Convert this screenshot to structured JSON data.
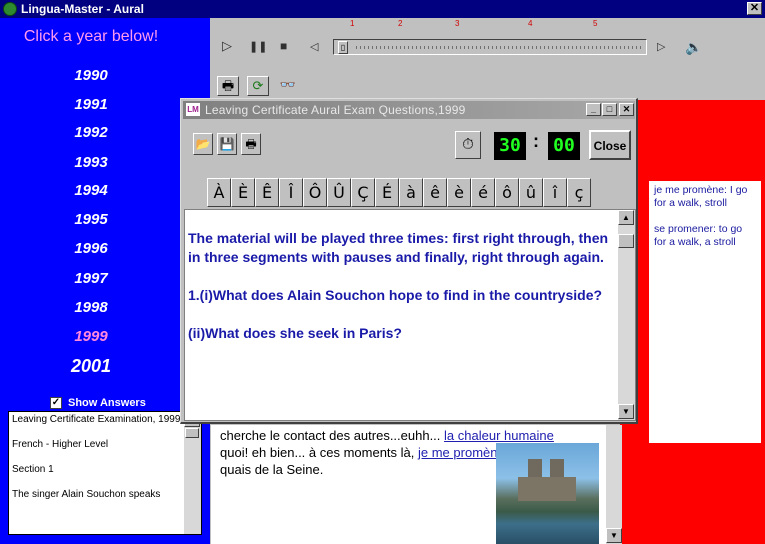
{
  "window": {
    "title": "Lingua-Master - Aural",
    "close_glyph": "✕"
  },
  "years_panel": {
    "heading": "Click a year below!",
    "years": [
      "1990",
      "1991",
      "1992",
      "1993",
      "1994",
      "1995",
      "1996",
      "1997",
      "1998",
      "1999",
      "2001"
    ],
    "selected_year": "1999"
  },
  "show_answers": {
    "label": "Show Answers",
    "checked": true,
    "check_glyph": "✓"
  },
  "info_box": {
    "lines": [
      "Leaving Certificate Examination, 1999",
      "French - Higher Level",
      "Section 1",
      "The singer Alain Souchon speaks"
    ]
  },
  "player": {
    "segment_markers": [
      "1",
      "2",
      "3",
      "4",
      "5"
    ],
    "play_glyph": "▷",
    "pause_glyph": "❚❚",
    "stop_glyph": "■",
    "prev_glyph": "◁",
    "next_glyph": "▷",
    "speaker_glyph": "🔈",
    "thumb_glyph": "▯"
  },
  "toolbar2": {
    "print_glyph": "🖶",
    "refresh_glyph": "⟳",
    "find_glyph": "👓"
  },
  "dialog": {
    "title": "Leaving Certificate Aural Exam Questions,1999",
    "icon_text": "LM",
    "minimize_glyph": "_",
    "maximize_glyph": "□",
    "close_glyph": "✕",
    "open_glyph": "📂",
    "save_glyph": "💾",
    "print_glyph": "🖶",
    "stopwatch_glyph": "⏱",
    "timer_minutes": "30",
    "timer_seconds": "00",
    "timer_sep": ":",
    "close_label": "Close",
    "accents": [
      "À",
      "È",
      "Ê",
      "Î",
      "Ô",
      "Û",
      "Ç",
      "É",
      "à",
      "ê",
      "è",
      "é",
      "ô",
      "û",
      "î",
      "ç"
    ],
    "questions": [
      "The material will be played three times: first right through, then in three segments with pauses and finally, right through again.",
      "1.(i)What does Alain Souchon hope to find in the countryside?",
      "(ii)What does she seek in Paris?"
    ]
  },
  "vocab": {
    "entries": [
      "je me promène: I go for a walk, stroll",
      "se promener: to go for a walk, a stroll"
    ]
  },
  "transcript": {
    "line1_text": "cherche le contact des autres...euhh... ",
    "line1_link": "la chaleur humaine",
    "line2_text": "quoi! eh bien... à ces moments là, ",
    "line2_link": "je me promène",
    "line2_rest": " à Paris, sur les quais de la Seine."
  },
  "scroll": {
    "up_glyph": "▲",
    "down_glyph": "▼"
  },
  "colors": {
    "panel_blue": "#0000ff",
    "title_blue": "#000080",
    "red_panel": "#ff0000",
    "question_text": "#1a1aa8",
    "timer_green": "#20ff20"
  }
}
